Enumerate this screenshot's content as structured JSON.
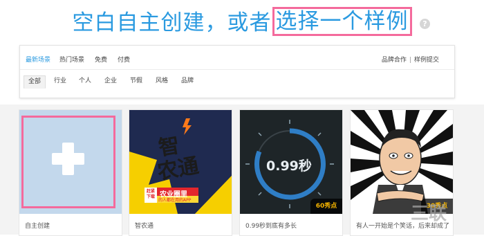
{
  "headline": {
    "prefix": "空白自主创建，或者",
    "highlight": "选择一个样例"
  },
  "help_icon": "?",
  "tabs": [
    {
      "label": "最新场景",
      "active": true
    },
    {
      "label": "热门场景",
      "active": false
    },
    {
      "label": "免费",
      "active": false
    },
    {
      "label": "付费",
      "active": false
    }
  ],
  "right_links": {
    "partner": "品牌合作",
    "submit": "样例提交",
    "sep": "|"
  },
  "subtabs": [
    {
      "label": "全部",
      "active": true
    },
    {
      "label": "行业",
      "active": false
    },
    {
      "label": "个人",
      "active": false
    },
    {
      "label": "企业",
      "active": false
    },
    {
      "label": "节假",
      "active": false
    },
    {
      "label": "风格",
      "active": false
    },
    {
      "label": "品牌",
      "active": false
    }
  ],
  "cards": [
    {
      "caption": "自主创建",
      "icon": "plus-icon"
    },
    {
      "caption": "智农通",
      "poster_title_1": "智",
      "poster_title_2": "农通",
      "ribbon": "农业圈里",
      "ribbon_sub": "的人都在用的APP",
      "ribbon_tag": "赶紧下载"
    },
    {
      "caption": "0.99秒到底有多长",
      "timer_text": "0.99秒",
      "price": "60秀点"
    },
    {
      "caption": "有人一开始是个笑话，后来却成了",
      "price": "30秀点"
    }
  ],
  "watermark": "三联"
}
